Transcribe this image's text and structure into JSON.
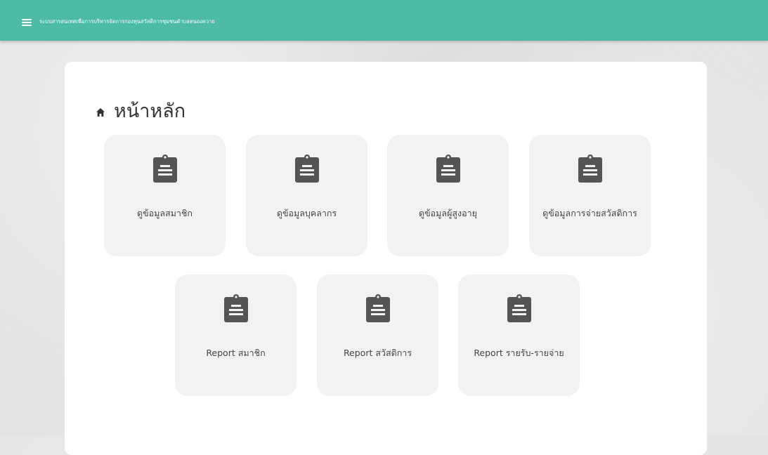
{
  "header": {
    "menu_icon": "hamburger-menu-icon",
    "title": "ระบบสารสนเทศเพื่อการบริหารจัดการกองทุนสวัสดิการชุมชนตำบลหนองควาย",
    "background_color": "#4dbaa4"
  },
  "page": {
    "title": "หน้าหลัก",
    "title_icon": "home-icon"
  },
  "tiles": [
    {
      "label": "ดูข้อมูลสมาชิก",
      "icon": "clipboard-icon"
    },
    {
      "label": "ดูข้อมูลบุคลากร",
      "icon": "clipboard-icon"
    },
    {
      "label": "ดูข้อมูลผู้สูงอายุ",
      "icon": "clipboard-icon"
    },
    {
      "label": "ดูข้อมูลการจ่ายสวัสดิการ",
      "icon": "clipboard-icon"
    },
    {
      "label": "Report สมาชิก",
      "icon": "clipboard-icon"
    },
    {
      "label": "Report สวัสดิการ",
      "icon": "clipboard-icon"
    },
    {
      "label": "Report รายรับ-รายจ่าย",
      "icon": "clipboard-icon"
    }
  ],
  "colors": {
    "tile_background": "#f2f2f2",
    "icon_color": "#545454",
    "page_background": "#e4e4e4"
  }
}
